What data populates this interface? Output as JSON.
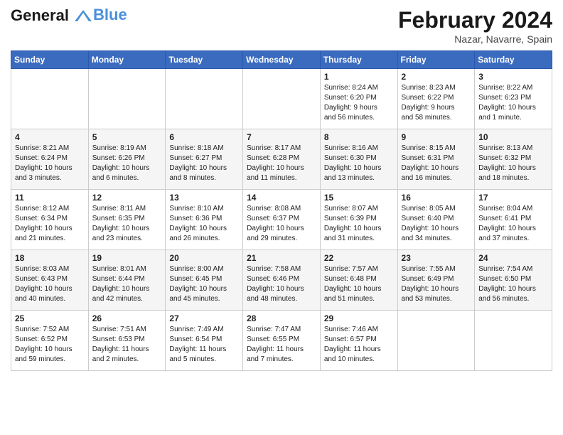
{
  "header": {
    "logo_line1": "General",
    "logo_line2": "Blue",
    "month_year": "February 2024",
    "location": "Nazar, Navarre, Spain"
  },
  "days_of_week": [
    "Sunday",
    "Monday",
    "Tuesday",
    "Wednesday",
    "Thursday",
    "Friday",
    "Saturday"
  ],
  "weeks": [
    [
      {
        "day": "",
        "info": ""
      },
      {
        "day": "",
        "info": ""
      },
      {
        "day": "",
        "info": ""
      },
      {
        "day": "",
        "info": ""
      },
      {
        "day": "1",
        "info": "Sunrise: 8:24 AM\nSunset: 6:20 PM\nDaylight: 9 hours\nand 56 minutes."
      },
      {
        "day": "2",
        "info": "Sunrise: 8:23 AM\nSunset: 6:22 PM\nDaylight: 9 hours\nand 58 minutes."
      },
      {
        "day": "3",
        "info": "Sunrise: 8:22 AM\nSunset: 6:23 PM\nDaylight: 10 hours\nand 1 minute."
      }
    ],
    [
      {
        "day": "4",
        "info": "Sunrise: 8:21 AM\nSunset: 6:24 PM\nDaylight: 10 hours\nand 3 minutes."
      },
      {
        "day": "5",
        "info": "Sunrise: 8:19 AM\nSunset: 6:26 PM\nDaylight: 10 hours\nand 6 minutes."
      },
      {
        "day": "6",
        "info": "Sunrise: 8:18 AM\nSunset: 6:27 PM\nDaylight: 10 hours\nand 8 minutes."
      },
      {
        "day": "7",
        "info": "Sunrise: 8:17 AM\nSunset: 6:28 PM\nDaylight: 10 hours\nand 11 minutes."
      },
      {
        "day": "8",
        "info": "Sunrise: 8:16 AM\nSunset: 6:30 PM\nDaylight: 10 hours\nand 13 minutes."
      },
      {
        "day": "9",
        "info": "Sunrise: 8:15 AM\nSunset: 6:31 PM\nDaylight: 10 hours\nand 16 minutes."
      },
      {
        "day": "10",
        "info": "Sunrise: 8:13 AM\nSunset: 6:32 PM\nDaylight: 10 hours\nand 18 minutes."
      }
    ],
    [
      {
        "day": "11",
        "info": "Sunrise: 8:12 AM\nSunset: 6:34 PM\nDaylight: 10 hours\nand 21 minutes."
      },
      {
        "day": "12",
        "info": "Sunrise: 8:11 AM\nSunset: 6:35 PM\nDaylight: 10 hours\nand 23 minutes."
      },
      {
        "day": "13",
        "info": "Sunrise: 8:10 AM\nSunset: 6:36 PM\nDaylight: 10 hours\nand 26 minutes."
      },
      {
        "day": "14",
        "info": "Sunrise: 8:08 AM\nSunset: 6:37 PM\nDaylight: 10 hours\nand 29 minutes."
      },
      {
        "day": "15",
        "info": "Sunrise: 8:07 AM\nSunset: 6:39 PM\nDaylight: 10 hours\nand 31 minutes."
      },
      {
        "day": "16",
        "info": "Sunrise: 8:05 AM\nSunset: 6:40 PM\nDaylight: 10 hours\nand 34 minutes."
      },
      {
        "day": "17",
        "info": "Sunrise: 8:04 AM\nSunset: 6:41 PM\nDaylight: 10 hours\nand 37 minutes."
      }
    ],
    [
      {
        "day": "18",
        "info": "Sunrise: 8:03 AM\nSunset: 6:43 PM\nDaylight: 10 hours\nand 40 minutes."
      },
      {
        "day": "19",
        "info": "Sunrise: 8:01 AM\nSunset: 6:44 PM\nDaylight: 10 hours\nand 42 minutes."
      },
      {
        "day": "20",
        "info": "Sunrise: 8:00 AM\nSunset: 6:45 PM\nDaylight: 10 hours\nand 45 minutes."
      },
      {
        "day": "21",
        "info": "Sunrise: 7:58 AM\nSunset: 6:46 PM\nDaylight: 10 hours\nand 48 minutes."
      },
      {
        "day": "22",
        "info": "Sunrise: 7:57 AM\nSunset: 6:48 PM\nDaylight: 10 hours\nand 51 minutes."
      },
      {
        "day": "23",
        "info": "Sunrise: 7:55 AM\nSunset: 6:49 PM\nDaylight: 10 hours\nand 53 minutes."
      },
      {
        "day": "24",
        "info": "Sunrise: 7:54 AM\nSunset: 6:50 PM\nDaylight: 10 hours\nand 56 minutes."
      }
    ],
    [
      {
        "day": "25",
        "info": "Sunrise: 7:52 AM\nSunset: 6:52 PM\nDaylight: 10 hours\nand 59 minutes."
      },
      {
        "day": "26",
        "info": "Sunrise: 7:51 AM\nSunset: 6:53 PM\nDaylight: 11 hours\nand 2 minutes."
      },
      {
        "day": "27",
        "info": "Sunrise: 7:49 AM\nSunset: 6:54 PM\nDaylight: 11 hours\nand 5 minutes."
      },
      {
        "day": "28",
        "info": "Sunrise: 7:47 AM\nSunset: 6:55 PM\nDaylight: 11 hours\nand 7 minutes."
      },
      {
        "day": "29",
        "info": "Sunrise: 7:46 AM\nSunset: 6:57 PM\nDaylight: 11 hours\nand 10 minutes."
      },
      {
        "day": "",
        "info": ""
      },
      {
        "day": "",
        "info": ""
      }
    ]
  ]
}
